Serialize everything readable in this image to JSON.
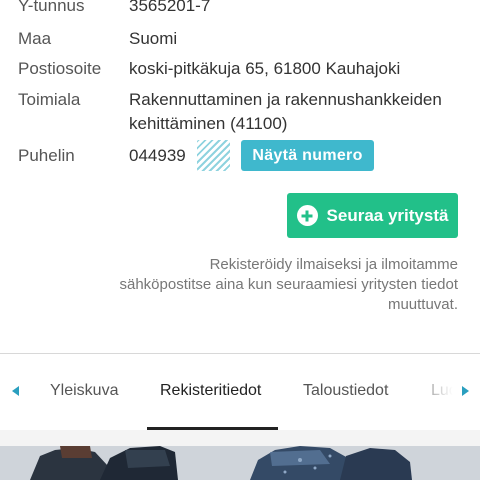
{
  "company_info": {
    "rows": [
      {
        "label": "Y-tunnus",
        "value": "3565201-7"
      },
      {
        "label": "Maa",
        "value": "Suomi"
      },
      {
        "label": "Postiosoite",
        "value": "koski-pitkäkuja 65, 61800 Kauhajoki"
      },
      {
        "label": "Toimiala",
        "value": "Rakennuttaminen ja rakennushankkeiden kehittäminen (41100)"
      },
      {
        "label": "Puhelin",
        "value": "044939"
      }
    ],
    "show_number_label": "Näytä numero"
  },
  "follow": {
    "button_label": "Seuraa yritystä",
    "note": "Rekisteröidy ilmaiseksi ja ilmoitamme sähköpostitse aina kun seuraamiesi yritysten tiedot muuttuvat."
  },
  "tabs": {
    "items": [
      {
        "label": "Yleiskuva",
        "active": false
      },
      {
        "label": "Rekisteritiedot",
        "active": true
      },
      {
        "label": "Taloustiedot",
        "active": false
      },
      {
        "label": "Luo",
        "active": false
      }
    ]
  },
  "colors": {
    "show_number_bg": "#3fb8cd",
    "follow_button_bg": "#22c089",
    "tab_arrow": "#2a9fbf"
  },
  "icons": {
    "follow": "plus-circle-icon",
    "tab_prev": "caret-left-icon",
    "tab_next": "caret-right-icon"
  }
}
